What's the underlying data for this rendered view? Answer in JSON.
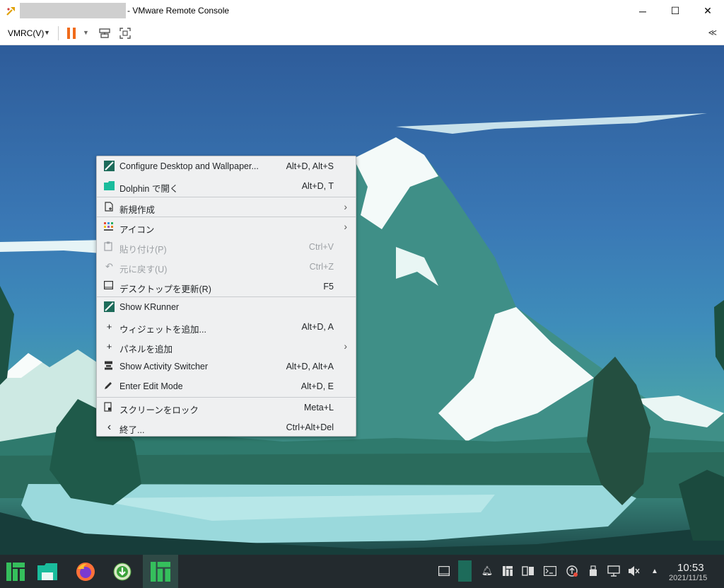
{
  "window": {
    "title": "- VMware Remote Console",
    "minimize": "─",
    "maximize": "☐",
    "close": "✕"
  },
  "toolbar": {
    "menu_label": "VMRC(V)",
    "collapse_label": "≪"
  },
  "context_menu": {
    "items": [
      {
        "label": "Configure Desktop and Wallpaper...",
        "shortcut": "Alt+D, Alt+S",
        "icon": "configure-icon"
      },
      {
        "label": "Dolphin で開く",
        "shortcut": "Alt+D, T",
        "icon": "folder-icon"
      },
      {
        "label": "新規作成",
        "shortcut": "",
        "icon": "new-document-icon",
        "submenu": "›"
      },
      {
        "label": "アイコン",
        "shortcut": "",
        "icon": "icons-grid-icon",
        "submenu": "›"
      },
      {
        "label": "貼り付け(P)",
        "shortcut": "Ctrl+V",
        "icon": "paste-icon",
        "disabled": true
      },
      {
        "label": "元に戻す(U)",
        "shortcut": "Ctrl+Z",
        "icon": "undo-icon",
        "disabled": true
      },
      {
        "label": "デスクトップを更新(R)",
        "shortcut": "F5",
        "icon": "refresh-desktop-icon"
      },
      {
        "label": "Show KRunner",
        "shortcut": "",
        "icon": "krunner-icon"
      },
      {
        "label": "ウィジェットを追加...",
        "shortcut": "Alt+D, A",
        "icon": "plus-icon"
      },
      {
        "label": "パネルを追加",
        "shortcut": "",
        "icon": "plus-icon",
        "submenu": "›"
      },
      {
        "label": "Show Activity Switcher",
        "shortcut": "Alt+D, Alt+A",
        "icon": "activities-icon"
      },
      {
        "label": "Enter Edit Mode",
        "shortcut": "Alt+D, E",
        "icon": "edit-icon"
      },
      {
        "label": "スクリーンをロック",
        "shortcut": "Meta+L",
        "icon": "lock-icon"
      },
      {
        "label": "終了...",
        "shortcut": "Ctrl+Alt+Del",
        "icon": "leave-icon"
      }
    ]
  },
  "taskbar": {
    "clock_time": "10:53",
    "clock_date": "2021/11/15"
  },
  "colors": {
    "accent": "#f06b1a",
    "taskbar": "#232a2e",
    "menu_bg": "#eff0f1",
    "manjaro_green": "#35bf5c"
  }
}
